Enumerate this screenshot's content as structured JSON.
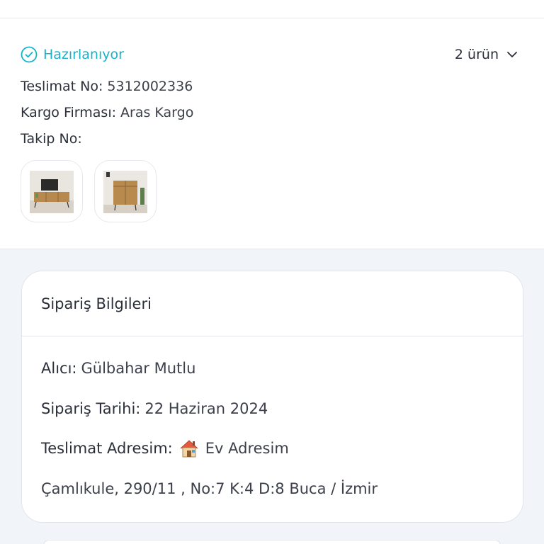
{
  "shipment": {
    "status": "Hazırlanıyor",
    "status_color": "#16b3c9",
    "item_count": "2 ürün",
    "delivery_no_label": "Teslimat No:",
    "delivery_no": "5312002336",
    "carrier_label": "Kargo Firması:",
    "carrier": "Aras Kargo",
    "tracking_label": "Takip No:",
    "tracking": "",
    "products": [
      {
        "icon": "tv-stand-image"
      },
      {
        "icon": "cabinet-image"
      }
    ]
  },
  "order_info": {
    "title": "Sipariş Bilgileri",
    "recipient_label": "Alıcı:",
    "recipient": "Gülbahar Mutlu",
    "date_label": "Sipariş Tarihi:",
    "date": "22 Haziran 2024",
    "address_label": "Teslimat Adresim:",
    "address_icon": "house-icon",
    "address_name": "Ev Adresim",
    "address_line": "Çamlıkule, 290/11 , No:7 K:4 D:8 Buca / İzmir"
  }
}
